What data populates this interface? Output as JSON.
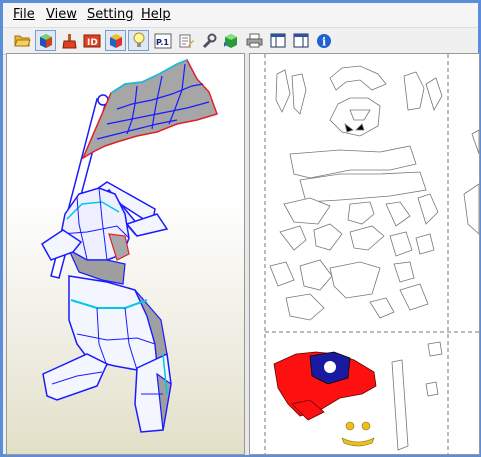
{
  "menu": {
    "file": "File",
    "view": "View",
    "setting": "Setting",
    "help": "Help"
  },
  "toolbar": {
    "tools": [
      {
        "icon": "open-folder-icon"
      },
      {
        "icon": "3d-view-icon"
      },
      {
        "icon": "brush-icon"
      },
      {
        "icon": "id-label-icon",
        "label": "ID"
      },
      {
        "icon": "color-cube-icon"
      },
      {
        "icon": "lightbulb-icon"
      },
      {
        "icon": "page-number-icon",
        "label": "P.1"
      },
      {
        "icon": "edit-text-icon"
      },
      {
        "icon": "settings-wrench-icon"
      },
      {
        "icon": "unfold-cube-icon"
      },
      {
        "icon": "print-icon"
      },
      {
        "icon": "split-view-left-icon"
      },
      {
        "icon": "split-view-right-icon"
      },
      {
        "icon": "info-icon"
      }
    ],
    "info_glyph": "i"
  },
  "colors": {
    "frame_blue": "#5a8ed8",
    "model_outline": "#1a1aff",
    "model_gray": "#9e9e9e",
    "flag_red": "#ff1010",
    "flag_blue": "#1a1aa0",
    "cyan_edge": "#00c8e8",
    "accent_yellow": "#e8c020"
  }
}
